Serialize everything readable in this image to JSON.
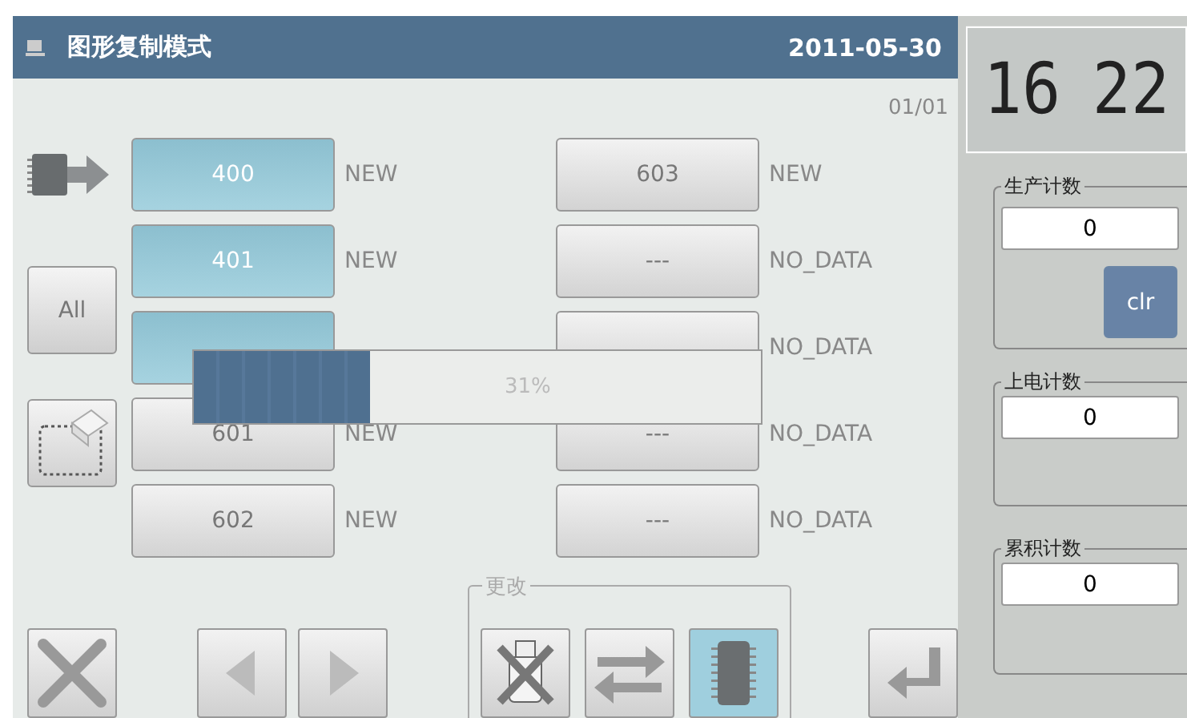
{
  "title_bar": {
    "title": "图形复制模式",
    "date": "2011-05-30"
  },
  "pager": "01/01",
  "side_buttons": [
    {
      "kind": "chip-arrow"
    },
    {
      "kind": "text",
      "label": "All"
    },
    {
      "kind": "eraser"
    }
  ],
  "rows": [
    {
      "left": {
        "button": "400",
        "status": "NEW",
        "selected": true
      },
      "right": {
        "button": "603",
        "status": "NEW",
        "selected": false
      }
    },
    {
      "left": {
        "button": "401",
        "status": "NEW",
        "selected": true
      },
      "right": {
        "button": "---",
        "status": "NO_DATA",
        "selected": false
      }
    },
    {
      "left": {
        "selected": true
      },
      "right": {
        "status": "NO_DATA",
        "selected": false
      }
    },
    {
      "left": {
        "button": "601",
        "status": "NEW",
        "selected": false
      },
      "right": {
        "button": "---",
        "status": "NO_DATA",
        "selected": false
      }
    },
    {
      "left": {
        "button": "602",
        "status": "NEW",
        "selected": false
      },
      "right": {
        "button": "---",
        "status": "NO_DATA",
        "selected": false
      }
    }
  ],
  "progress": {
    "level": 0.31,
    "reading": "31%"
  },
  "bottom": {
    "buttons": [
      {
        "kind": "cancel"
      },
      {
        "kind": "prev"
      },
      {
        "kind": "next"
      }
    ],
    "change_group": {
      "label": "更改",
      "buttons": [
        {
          "kind": "usb-off",
          "selected": false
        },
        {
          "kind": "swap",
          "selected": false
        },
        {
          "kind": "chip",
          "selected": true
        }
      ]
    },
    "enter": {
      "kind": "enter"
    }
  },
  "clock": {
    "hours": "16",
    "minutes": "22"
  },
  "counters": [
    {
      "label": "生产计数",
      "value": "0",
      "button": "clr"
    },
    {
      "label": "上电计数",
      "value": "0"
    },
    {
      "label": "累积计数",
      "value": "0"
    }
  ]
}
